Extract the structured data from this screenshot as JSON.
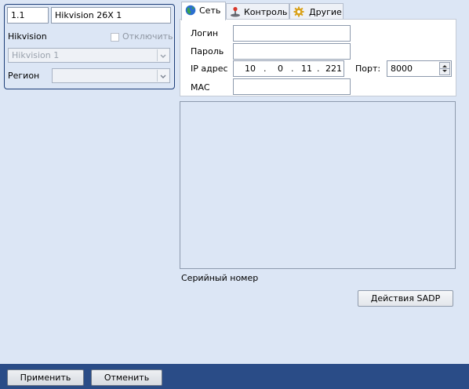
{
  "object_panel": {
    "id_value": "1.1",
    "name_value": "Hikvision 26X 1",
    "vendor_label": "Hikvision",
    "disable_label": "Отключить",
    "model_value": "Hikvision 1",
    "region_label": "Регион",
    "region_value": ""
  },
  "tabs": [
    {
      "label": "Сеть",
      "icon": "globe-icon"
    },
    {
      "label": "Контроль",
      "icon": "joystick-icon"
    },
    {
      "label": "Другие",
      "icon": "gear-icon"
    }
  ],
  "network": {
    "login_label": "Логин",
    "login_value": "",
    "password_label": "Пароль",
    "password_value": "",
    "ip_label": "IP адрес",
    "ip": [
      "10",
      "0",
      "11",
      "221"
    ],
    "ip_dot": ".",
    "port_label": "Порт:",
    "port_value": "8000",
    "mac_label": "MAC",
    "mac_value": ""
  },
  "serial_label": "Серийный номер",
  "sadp_button": "Действия SADP",
  "apply_button": "Применить",
  "cancel_button": "Отменить",
  "colors": {
    "accent": "#2a4c87",
    "panel_bg": "#dce6f5",
    "panel_border": "#1e3f79"
  }
}
